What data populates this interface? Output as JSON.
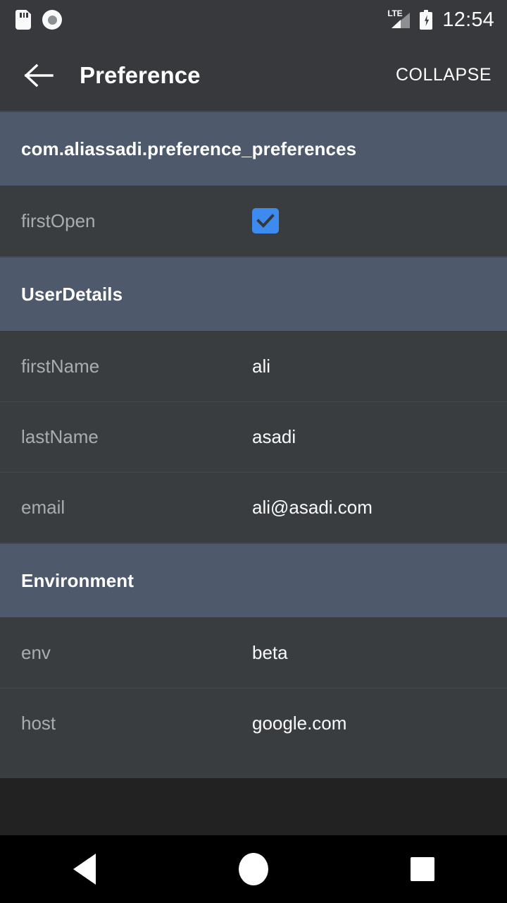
{
  "status_bar": {
    "icons_left": [
      "sd-card-icon",
      "screen-record-icon"
    ],
    "network_label": "LTE",
    "icons_right": [
      "signal-icon",
      "battery-charging-icon"
    ],
    "time": "12:54"
  },
  "app_bar": {
    "back_icon": "back-arrow-icon",
    "title": "Preference",
    "action_label": "COLLAPSE"
  },
  "sections": [
    {
      "header": "com.aliassadi.preference_preferences",
      "rows": [
        {
          "key": "firstOpen",
          "type": "checkbox",
          "checked": true,
          "value": ""
        }
      ]
    },
    {
      "header": "UserDetails",
      "rows": [
        {
          "key": "firstName",
          "type": "text",
          "value": "ali"
        },
        {
          "key": "lastName",
          "type": "text",
          "value": "asadi"
        },
        {
          "key": "email",
          "type": "text",
          "value": "ali@asadi.com"
        }
      ]
    },
    {
      "header": "Environment",
      "rows": [
        {
          "key": "env",
          "type": "text",
          "value": "beta"
        },
        {
          "key": "host",
          "type": "text",
          "value": "google.com"
        }
      ]
    }
  ],
  "nav_bar": {
    "back": "back-triangle-icon",
    "home": "home-circle-icon",
    "recents": "recents-square-icon"
  },
  "colors": {
    "status_bar_bg": "#37393c",
    "app_bar_bg": "#37393c",
    "section_header_bg": "#4e596b",
    "row_bg": "#3a3d40",
    "page_bg": "#222222",
    "checkbox_accent": "#3d8bef",
    "key_text": "#a9adb0",
    "value_text": "#fafafa",
    "nav_bar_bg": "#000000"
  }
}
